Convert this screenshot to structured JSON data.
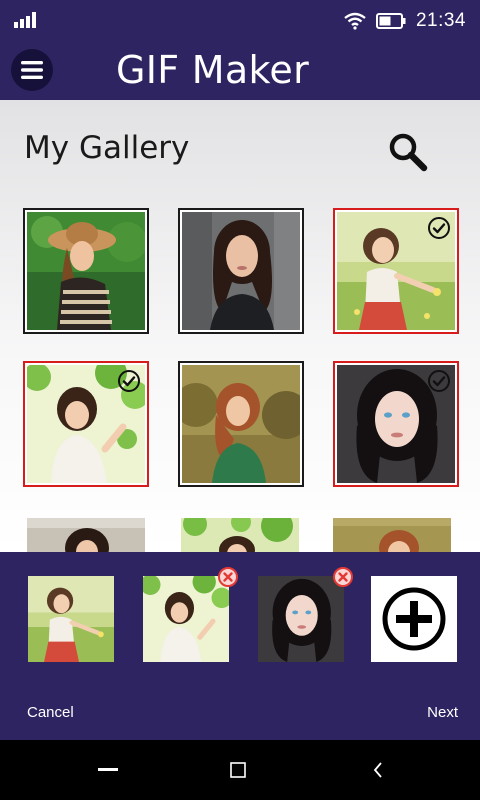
{
  "status_bar": {
    "time": "21:34",
    "signal_icon": "signal-bars-icon",
    "wifi_icon": "wifi-icon",
    "battery_icon": "battery-icon"
  },
  "app_bar": {
    "title": "GIF Maker",
    "menu_icon": "hamburger-menu-icon"
  },
  "gallery": {
    "title": "My Gallery",
    "search_icon": "search-icon",
    "photos": [
      {
        "label": "girl-straw-hat",
        "selected": false
      },
      {
        "label": "woman-dark-hair-leather-jacket",
        "selected": false
      },
      {
        "label": "little-girl-meadow",
        "selected": true
      },
      {
        "label": "girl-leaves-white-shirt",
        "selected": true
      },
      {
        "label": "woman-red-hair-green-dress",
        "selected": false
      },
      {
        "label": "girl-blue-eyes-dark-hair",
        "selected": true
      },
      {
        "label": "girl-dark-hair-partial",
        "selected": false
      },
      {
        "label": "girl-leaves-partial",
        "selected": false
      },
      {
        "label": "woman-red-hair-partial",
        "selected": false
      }
    ]
  },
  "tray": {
    "items": [
      {
        "label": "little-girl-meadow",
        "removable": false
      },
      {
        "label": "girl-leaves-white-shirt",
        "removable": true
      },
      {
        "label": "girl-blue-eyes-dark-hair",
        "removable": true
      }
    ],
    "add_icon": "plus-circle-icon",
    "cancel_label": "Cancel",
    "next_label": "Next"
  },
  "nav_bar": {
    "home_icon": "minus-icon",
    "recents_icon": "square-icon",
    "back_icon": "chevron-left-icon"
  },
  "colors": {
    "primary": "#2e2462",
    "selected_border": "#d81b1b",
    "remove_badge": "#e53935"
  }
}
